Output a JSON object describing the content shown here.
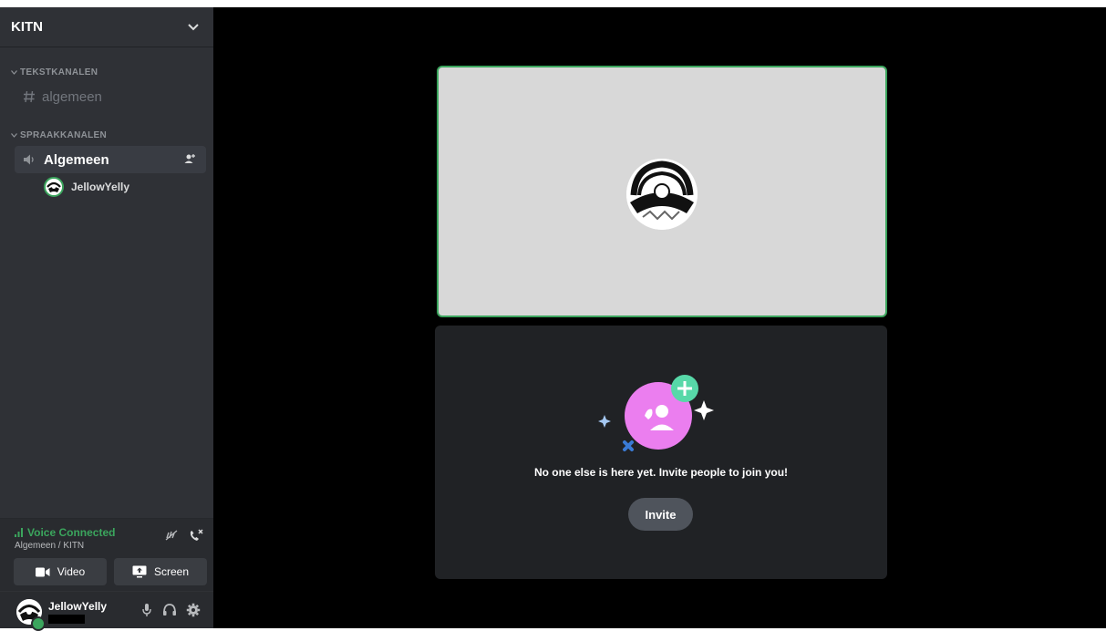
{
  "server": {
    "name": "KITN"
  },
  "categories": {
    "text": "TEKSTKANALEN",
    "voice": "SPRAAKKANALEN"
  },
  "channels": {
    "text": "algemeen",
    "voice": "Algemeen"
  },
  "voice_user": {
    "name": "JellowYelly"
  },
  "voice_panel": {
    "status": "Voice Connected",
    "location": "Algemeen / KITN",
    "video_label": "Video",
    "screen_label": "Screen"
  },
  "user_panel": {
    "username": "JellowYelly"
  },
  "empty_state": {
    "message": "No one else is here yet. Invite people to join you!",
    "invite_label": "Invite"
  },
  "colors": {
    "connected_green": "#3ba55d",
    "invite_pink": "#eb7eef",
    "invite_plus_teal": "#57d8a8",
    "sidebar_bg": "#2f3136",
    "accent_blue": "#3a7bd5"
  },
  "icons": {
    "server_menu": "chevron-down-icon",
    "text_channel": "hash-icon",
    "voice_channel": "speaker-icon",
    "add_member": "add-user-icon",
    "signal": "signal-bars-icon",
    "noise_suppression": "noise-suppression-icon",
    "disconnect": "disconnect-icon",
    "video": "camera-icon",
    "screen": "screen-share-icon",
    "mic": "microphone-icon",
    "headphones": "headphones-icon",
    "settings": "gear-icon"
  }
}
